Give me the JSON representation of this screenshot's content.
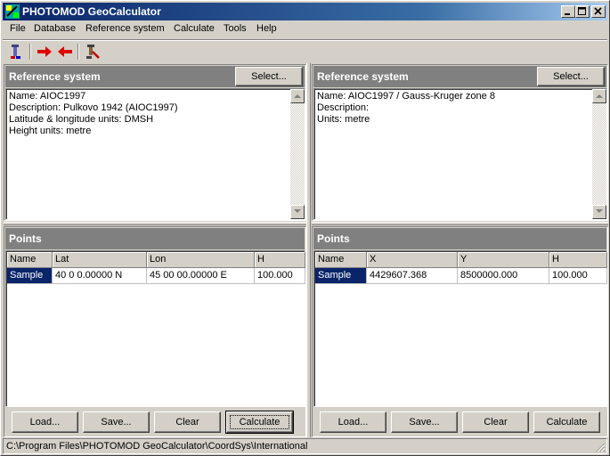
{
  "window": {
    "title": "PHOTOMOD GeoCalculator",
    "icon": "globe-app-icon",
    "controls": [
      "minimize-icon",
      "maximize-icon",
      "close-icon"
    ]
  },
  "menu": {
    "items": [
      "File",
      "Database",
      "Reference system",
      "Calculate",
      "Tools",
      "Help"
    ]
  },
  "toolbar": {
    "tools": [
      "transform-tool-icon",
      "arrow-right-icon",
      "arrow-left-icon",
      "settings-tool-icon"
    ]
  },
  "left": {
    "ref_header": "Reference system",
    "select_label": "Select...",
    "info_lines": [
      "Name: AIOC1997",
      "Description: Pulkovo 1942 (AIOC1997)",
      "Latitude & longitude units: DMSH",
      "Height units: metre"
    ],
    "points_header": "Points",
    "columns": [
      "Name",
      "Lat",
      "Lon",
      "H"
    ],
    "rows": [
      [
        "Sample",
        "40 0 0.00000 N",
        "45 00 00.00000 E",
        "100.000"
      ]
    ],
    "buttons": {
      "load": "Load...",
      "save": "Save...",
      "clear": "Clear",
      "calculate": "Calculate"
    }
  },
  "right": {
    "ref_header": "Reference system",
    "select_label": "Select...",
    "info_lines": [
      "Name: AIOC1997 / Gauss-Kruger zone 8",
      "Description:",
      "Units: metre"
    ],
    "points_header": "Points",
    "columns": [
      "Name",
      "X",
      "Y",
      "H"
    ],
    "rows": [
      [
        "Sample",
        "4429607.368",
        "8500000.000",
        "100.000"
      ]
    ],
    "buttons": {
      "load": "Load...",
      "save": "Save...",
      "clear": "Clear",
      "calculate": "Calculate"
    }
  },
  "status": {
    "path": "C:\\Program Files\\PHOTOMOD GeoCalculator\\CoordSys\\International"
  },
  "colors": {
    "title_active": "#0a246a",
    "selection": "#0a246a",
    "panel_header": "#808080",
    "face": "#d4d0c8"
  }
}
